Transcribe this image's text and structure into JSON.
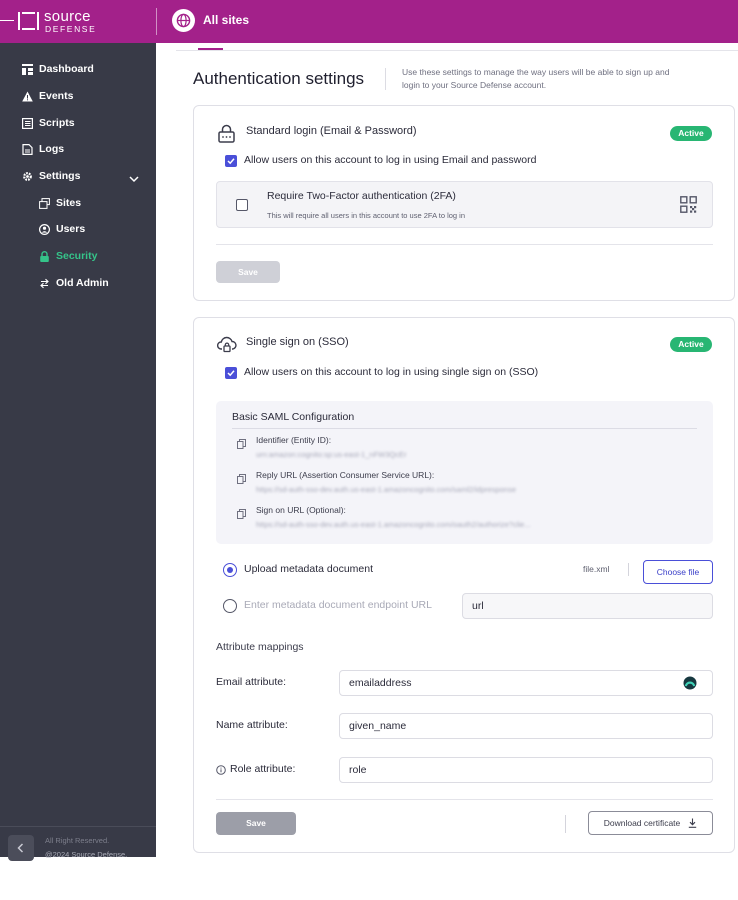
{
  "header": {
    "logo_top": "source",
    "logo_bottom": "DEFENSE",
    "site_selector": "All sites"
  },
  "sidebar": {
    "items": [
      {
        "label": "Dashboard",
        "icon": "dashboard-icon"
      },
      {
        "label": "Events",
        "icon": "warning-icon"
      },
      {
        "label": "Scripts",
        "icon": "scripts-icon"
      },
      {
        "label": "Logs",
        "icon": "logs-icon"
      },
      {
        "label": "Settings",
        "icon": "gear-icon"
      },
      {
        "label": "Sites",
        "icon": "sites-icon"
      },
      {
        "label": "Users",
        "icon": "users-icon"
      },
      {
        "label": "Security",
        "icon": "lock-icon",
        "active": true
      },
      {
        "label": "Old Admin",
        "icon": "swap-icon"
      }
    ],
    "footer_line1": "All Right Reserved.",
    "footer_line2": "@2024 Source Defense."
  },
  "page": {
    "title": "Authentication settings",
    "description": "Use these settings to manage the way users will be able to sign up and login to your Source Defense account."
  },
  "standard_login": {
    "title": "Standard login (Email & Password)",
    "status": "Active",
    "allow_label": "Allow users on this account to log in using Email and password",
    "allow_checked": true,
    "twofa_title": "Require Two-Factor authentication (2FA)",
    "twofa_desc": "This will require all users in this account to use 2FA to log in",
    "twofa_checked": false,
    "save_label": "Save"
  },
  "sso": {
    "title": "Single sign on (SSO)",
    "status": "Active",
    "allow_label": "Allow users on this account to log in using single sign on (SSO)",
    "allow_checked": true,
    "saml": {
      "title": "Basic SAML Configuration",
      "rows": [
        {
          "label": "Identifier (Entity ID):",
          "value": "urn:amazon:cognito:sp:us-east-1_nFW3QcEr"
        },
        {
          "label": "Reply URL (Assertion Consumer Service URL):",
          "value": "https://sd-auth-sso-dev.auth.us-east-1.amazoncognito.com/saml2/idpresponse"
        },
        {
          "label": "Sign on URL (Optional):",
          "value": "https://sd-auth-sso-dev.auth.us-east-1.amazoncognito.com/oauth2/authorize?clie..."
        }
      ]
    },
    "upload_label": "Upload metadata document",
    "file_name": "file.xml",
    "choose_file_label": "Choose file",
    "endpoint_placeholder": "Enter metadata document endpoint URL",
    "url_value": "url",
    "attribute_mappings_label": "Attribute mappings",
    "email_attr_label": "Email attribute:",
    "email_attr_value": "emailaddress",
    "name_attr_label": "Name attribute:",
    "name_attr_value": "given_name",
    "role_attr_label": "Role attribute:",
    "role_attr_value": "role",
    "save_label": "Save",
    "download_label": "Download certificate"
  },
  "colors": {
    "brand": "#a3218a",
    "sidebar": "#383a47",
    "active": "#28b673",
    "primary": "#4a4fd8"
  }
}
